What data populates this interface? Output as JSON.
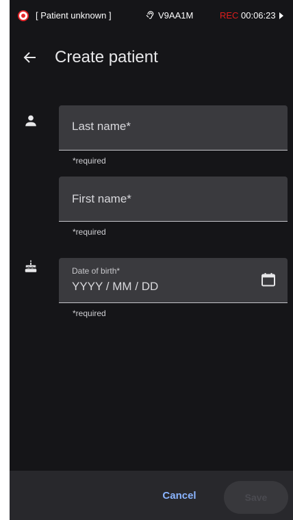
{
  "status_bar": {
    "patient_label": "[ Patient unknown ]",
    "device_id": "V9AA1M",
    "rec_label": "REC",
    "timer": "00:06:23"
  },
  "app_bar": {
    "title": "Create patient"
  },
  "form": {
    "last_name": {
      "label": "Last name*",
      "helper": "*required"
    },
    "first_name": {
      "label": "First name*",
      "helper": "*required"
    },
    "date_of_birth": {
      "label": "Date of birth*",
      "placeholder": "YYYY / MM / DD",
      "helper": "*required"
    }
  },
  "actions": {
    "cancel_label": "Cancel",
    "save_label": "Save"
  },
  "colors": {
    "background": "#151518",
    "field_background": "#3a3a3e",
    "accent": "#8ab4ff",
    "recording": "#e5262a"
  }
}
